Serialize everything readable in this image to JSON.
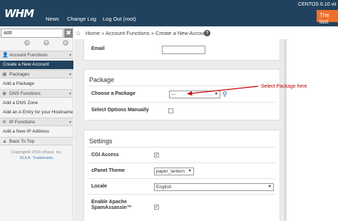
{
  "header": {
    "logo": "WHM",
    "nav": [
      "News",
      "Change Log",
      "Log Out (root)"
    ],
    "server_info": "CENTOS 6.10 vir",
    "latest_button": "The last"
  },
  "sidebar": {
    "search_value": "add",
    "clear_glyph": "✖",
    "categories": [
      {
        "label": "Account Functions",
        "icon": "person-icon",
        "items": [
          "Create a New Account"
        ]
      },
      {
        "label": "Packages",
        "icon": "package-icon",
        "items": [
          "Add a Package"
        ]
      },
      {
        "label": "DNS Functions",
        "icon": "dns-icon",
        "items": [
          "Add a DNS Zone",
          "Add an A Entry for your Hostname"
        ]
      },
      {
        "label": "IP Functions",
        "icon": "ip-icon",
        "items": [
          "Add a New IP Address"
        ]
      }
    ],
    "back_to_top": "Back To Top",
    "footer": {
      "copyright": "Copyright© 2018 cPanel, Inc.",
      "eula": "EULA",
      "trademarks": "Trademarks"
    }
  },
  "breadcrumb": {
    "text": "Home » Account Functions » Create a New Account",
    "home_icon": "home-icon",
    "help_icon": "help-icon"
  },
  "form": {
    "email_label": "Email",
    "package_section_title": "Package",
    "choose_package_label": "Choose a Package",
    "package_select_value": "---",
    "select_options_label": "Select Options Manually",
    "settings_title": "Settings",
    "cgi_label": "CGI Access",
    "theme_label": "cPanel Theme",
    "theme_value": "paper_lantern",
    "locale_label": "Locale",
    "locale_value": "English",
    "spam_label_1": "Enable Apache",
    "spam_label_2": "SpamAssassin™"
  },
  "annotation": {
    "text": "Select Package here",
    "color": "#cc0000"
  },
  "colors": {
    "header_bg": "#21425e",
    "active_item_bg": "#21425e",
    "accent": "#ef6f28"
  }
}
